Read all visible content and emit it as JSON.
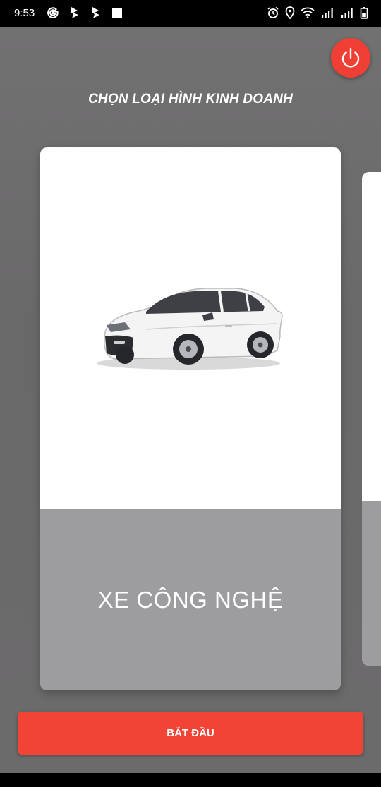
{
  "status_bar": {
    "time": "9:53",
    "left_icons": [
      "google-icon",
      "app-notification-icon",
      "app-notification-icon",
      "image-notification-icon"
    ],
    "right_icons": [
      "alarm-icon",
      "location-icon",
      "wifi-icon",
      "signal-icon",
      "signal-icon",
      "battery-icon"
    ]
  },
  "header": {
    "title": "CHỌN LOẠI HÌNH KINH DOANH",
    "power_icon": "power-icon"
  },
  "cards": [
    {
      "label": "XE CÔNG NGHỆ",
      "image": "white-sedan-car"
    }
  ],
  "footer": {
    "start_label": "BẮT ĐẦU"
  },
  "colors": {
    "accent": "#f24436",
    "background": "#6e6d6e",
    "card_label_bg": "#9d9c9f"
  }
}
